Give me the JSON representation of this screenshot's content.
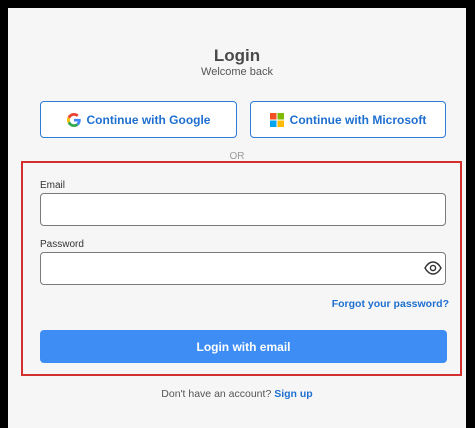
{
  "header": {
    "title": "Login",
    "subtitle": "Welcome back"
  },
  "oauth": {
    "google_label": "Continue with Google",
    "google_icon": "google-icon",
    "microsoft_label": "Continue with Microsoft",
    "microsoft_icon": "microsoft-icon"
  },
  "divider": {
    "text": "OR"
  },
  "form": {
    "email_label": "Email",
    "email_value": "",
    "password_label": "Password",
    "password_value": "",
    "toggle_visibility_icon": "eye-icon",
    "forgot_label": "Forgot your password?",
    "submit_label": "Login with email"
  },
  "footer": {
    "prompt": "Don't have an account?",
    "signup_label": "Sign up"
  },
  "colors": {
    "accent": "#3d8df5",
    "link": "#1e6fd0",
    "highlight_border": "#d32f2f",
    "background": "#f6f6f6"
  }
}
